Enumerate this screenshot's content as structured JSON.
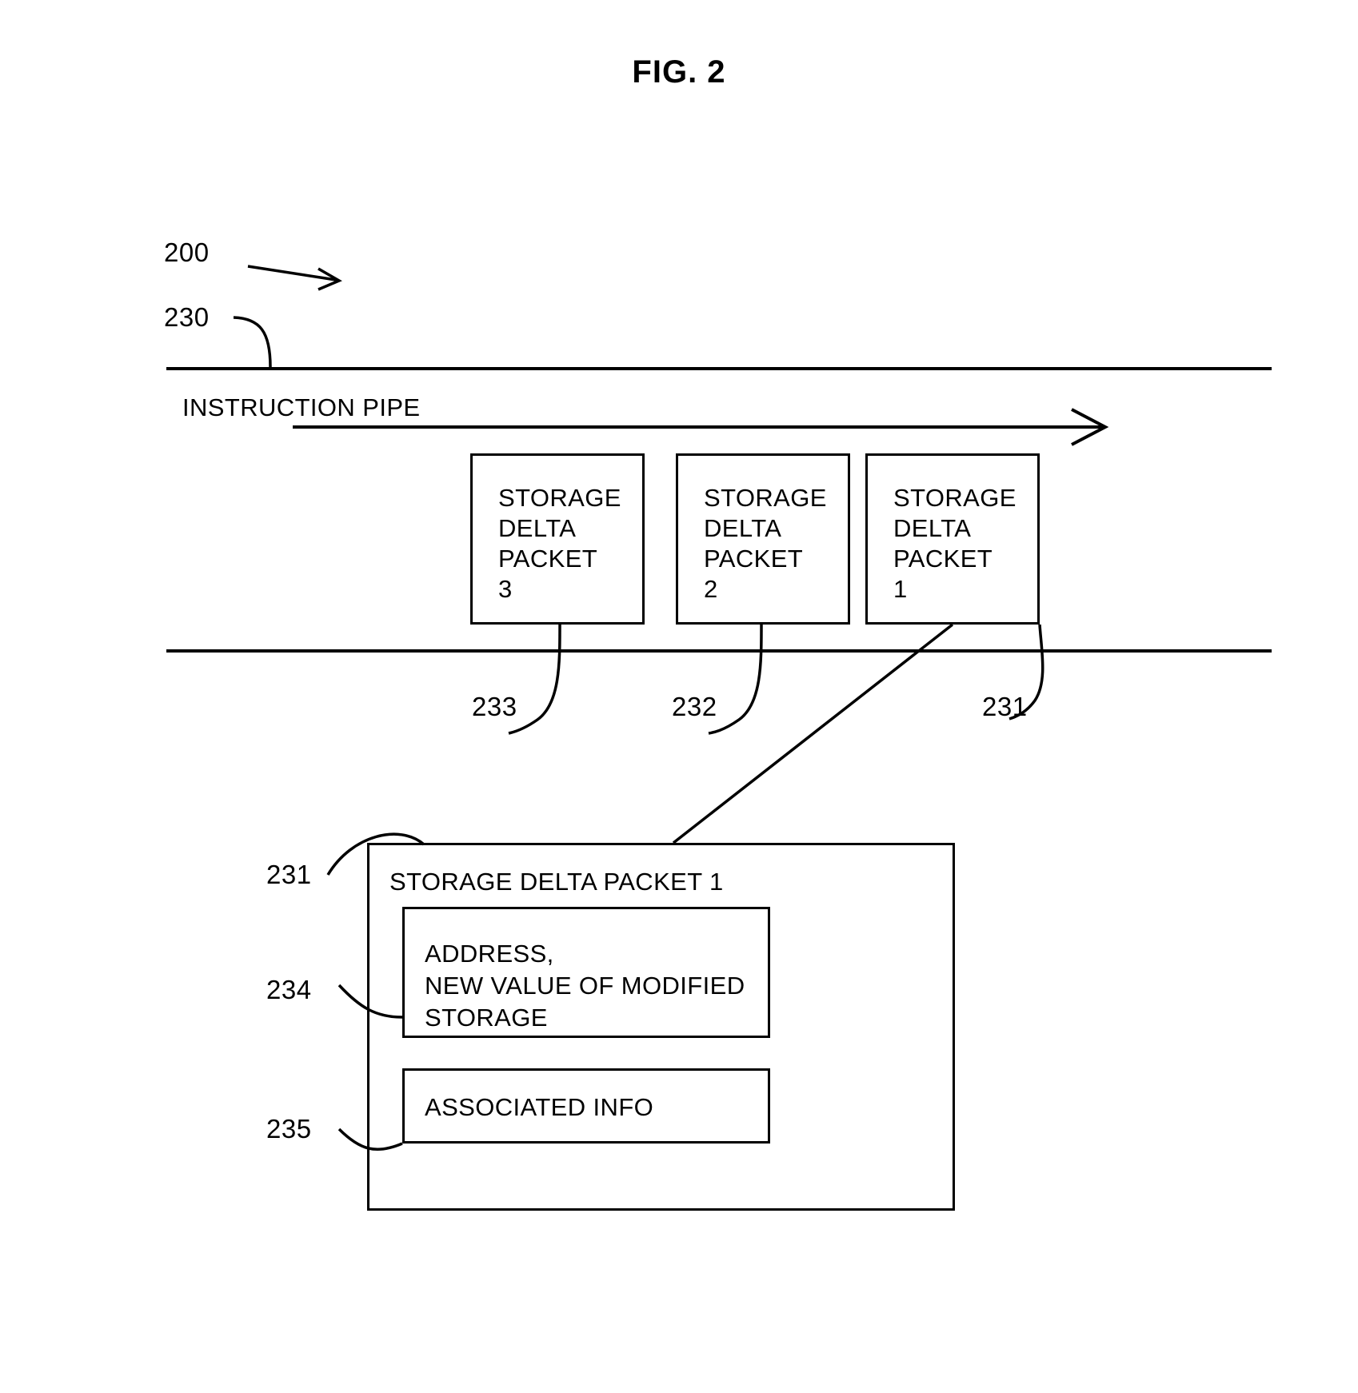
{
  "figure": {
    "title": "FIG. 2",
    "system_ref": "200"
  },
  "pipe": {
    "ref": "230",
    "label": "INSTRUCTION PIPE",
    "flow_arrow": "right-arrow-icon"
  },
  "packets": [
    {
      "ref": "233",
      "label": "STORAGE\nDELTA\nPACKET\n3"
    },
    {
      "ref": "232",
      "label": "STORAGE\nDELTA\nPACKET\n2"
    },
    {
      "ref": "231",
      "label": "STORAGE\nDELTA\nPACKET\n1"
    }
  ],
  "detail": {
    "ref": "231",
    "title": "STORAGE DELTA PACKET 1",
    "fields": [
      {
        "ref": "234",
        "text": "ADDRESS,\nNEW VALUE OF MODIFIED\nSTORAGE"
      },
      {
        "ref": "235",
        "text": "ASSOCIATED INFO"
      }
    ]
  },
  "colors": {
    "ink": "#000000",
    "paper": "#ffffff"
  }
}
